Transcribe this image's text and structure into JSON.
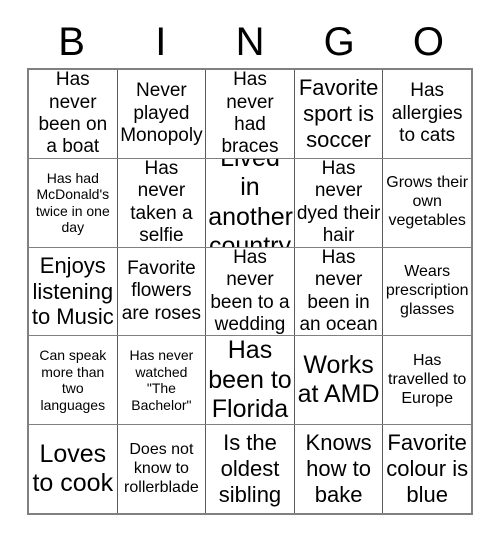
{
  "card": {
    "title": "BINGO",
    "header_letters": [
      "B",
      "I",
      "N",
      "G",
      "O"
    ],
    "columns": 5,
    "rows": 5,
    "colors": {
      "background": "#ffffff",
      "text": "#000000",
      "grid_line": "#808080",
      "outer_border": "#808080"
    },
    "cells": [
      [
        {
          "text": "Has never been on a boat",
          "size": "md"
        },
        {
          "text": "Never played Monopoly",
          "size": "md"
        },
        {
          "text": "Has never had braces",
          "size": "md"
        },
        {
          "text": "Favorite sport is soccer",
          "size": "lg"
        },
        {
          "text": "Has allergies to cats",
          "size": "md"
        }
      ],
      [
        {
          "text": "Has had McDonald's twice in one day",
          "size": "xs"
        },
        {
          "text": "Has never taken a selfie",
          "size": "md"
        },
        {
          "text": "Lived in another country",
          "size": "xl"
        },
        {
          "text": "Has never dyed their hair",
          "size": "md"
        },
        {
          "text": "Grows their own vegetables",
          "size": "sm"
        }
      ],
      [
        {
          "text": "Enjoys listening to Music",
          "size": "lg"
        },
        {
          "text": "Favorite flowers are roses",
          "size": "md"
        },
        {
          "text": "Has never been to a wedding",
          "size": "md"
        },
        {
          "text": "Has never been in an ocean",
          "size": "md"
        },
        {
          "text": "Wears prescription glasses",
          "size": "sm"
        }
      ],
      [
        {
          "text": "Can speak more than two languages",
          "size": "xs"
        },
        {
          "text": "Has never watched \"The Bachelor\"",
          "size": "xs"
        },
        {
          "text": "Has been to Florida",
          "size": "xl"
        },
        {
          "text": "Works at AMD",
          "size": "xl"
        },
        {
          "text": "Has travelled to Europe",
          "size": "sm"
        }
      ],
      [
        {
          "text": "Loves to cook",
          "size": "xl"
        },
        {
          "text": "Does not know to rollerblade",
          "size": "sm"
        },
        {
          "text": "Is the oldest sibling",
          "size": "lg"
        },
        {
          "text": "Knows how to bake",
          "size": "lg"
        },
        {
          "text": "Favorite colour is blue",
          "size": "lg"
        }
      ]
    ]
  }
}
